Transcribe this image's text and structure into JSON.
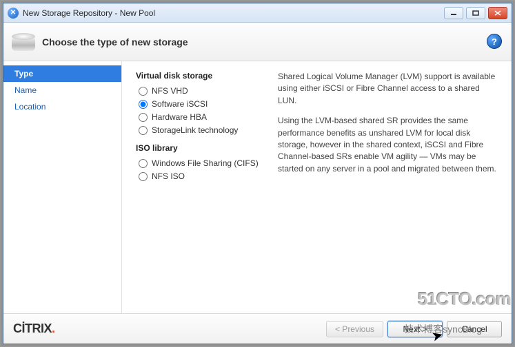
{
  "window_title": "New Storage Repository - New Pool",
  "header_title": "Choose the type of new storage",
  "sidebar": {
    "steps": [
      {
        "label": "Type",
        "active": true
      },
      {
        "label": "Name",
        "active": false
      },
      {
        "label": "Location",
        "active": false
      }
    ]
  },
  "groups": {
    "virtual_title": "Virtual disk storage",
    "iso_title": "ISO library"
  },
  "options": {
    "nfs_vhd": "NFS VHD",
    "software_iscsi": "Software iSCSI",
    "hardware_hba": "Hardware HBA",
    "storagelink": "StorageLink technology",
    "cifs": "Windows File Sharing (CIFS)",
    "nfs_iso": "NFS ISO"
  },
  "selected_option": "software_iscsi",
  "description": {
    "p1": "Shared Logical Volume Manager (LVM) support is available using either iSCSI or Fibre Channel access to a shared LUN.",
    "p2": "Using the LVM-based shared SR provides the same performance benefits as unshared LVM for local disk storage, however in the shared context, iSCSI and Fibre Channel-based SRs enable VM agility — VMs may be started on any server in a pool and migrated between them."
  },
  "footer": {
    "brand": "CİTRIX",
    "previous": "< Previous",
    "next": "Next >",
    "cancel": "Cancel"
  },
  "watermarks": {
    "site": "51CTO.com",
    "blog": "技术博客syncBlog"
  }
}
